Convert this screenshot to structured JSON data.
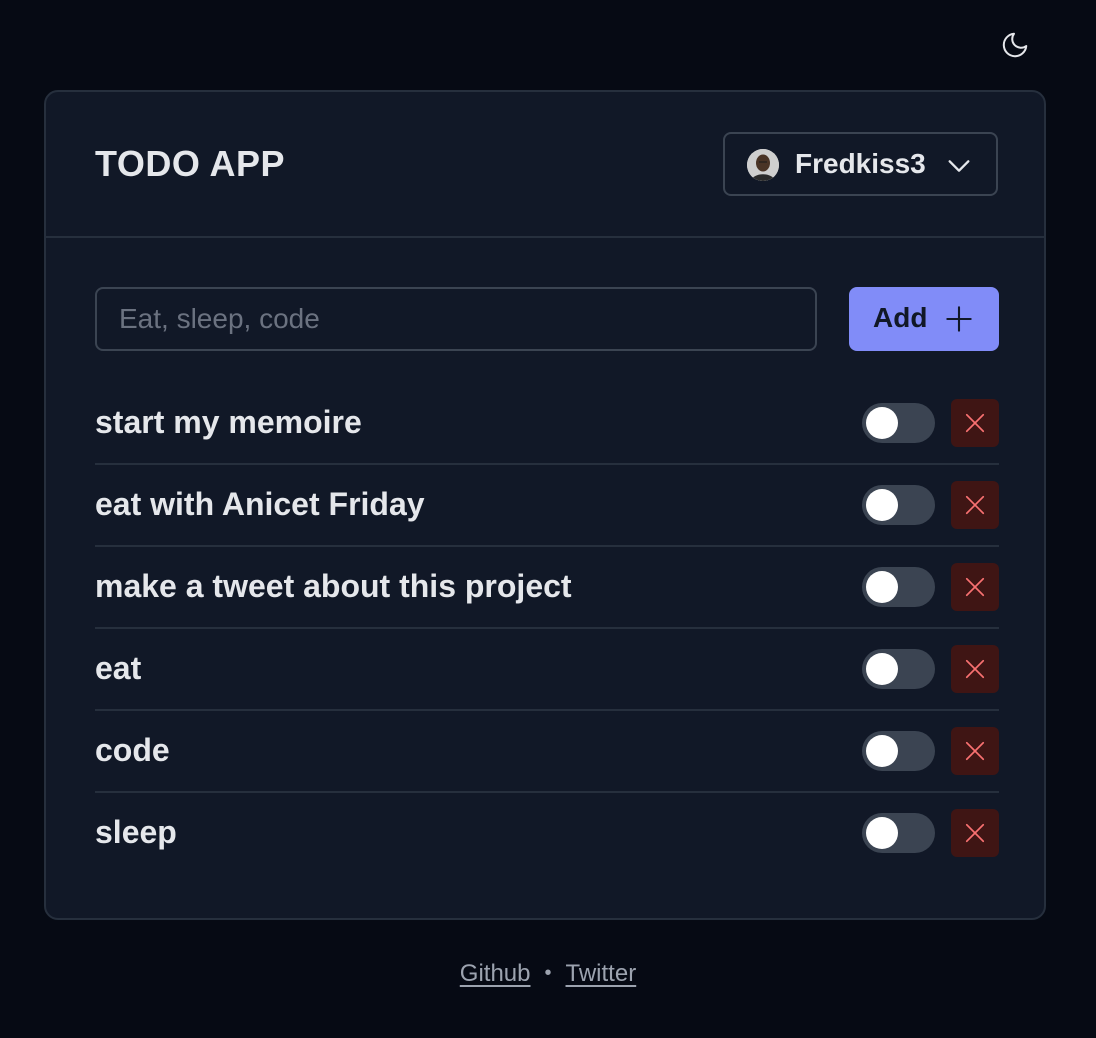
{
  "header": {
    "theme_icon": "moon-icon"
  },
  "card": {
    "title": "TODO APP",
    "user": {
      "name": "Fredkiss3",
      "avatar_icon": "avatar",
      "dropdown_icon": "chevron-down-icon"
    },
    "new_task": {
      "placeholder": "Eat, sleep, code",
      "value": "",
      "add_label": "Add",
      "add_icon": "plus-icon",
      "accent_color": "#818cf8"
    },
    "todos": [
      {
        "text": "start my memoire",
        "done": false
      },
      {
        "text": "eat with Anicet Friday",
        "done": false
      },
      {
        "text": "make a tweet about this project",
        "done": false
      },
      {
        "text": "eat",
        "done": false
      },
      {
        "text": "code",
        "done": false
      },
      {
        "text": "sleep",
        "done": false
      }
    ],
    "delete_icon": "close-icon",
    "delete_color": "#f87171"
  },
  "footer": {
    "links": [
      {
        "label": "Github"
      },
      {
        "label": "Twitter"
      }
    ],
    "separator": "•"
  }
}
